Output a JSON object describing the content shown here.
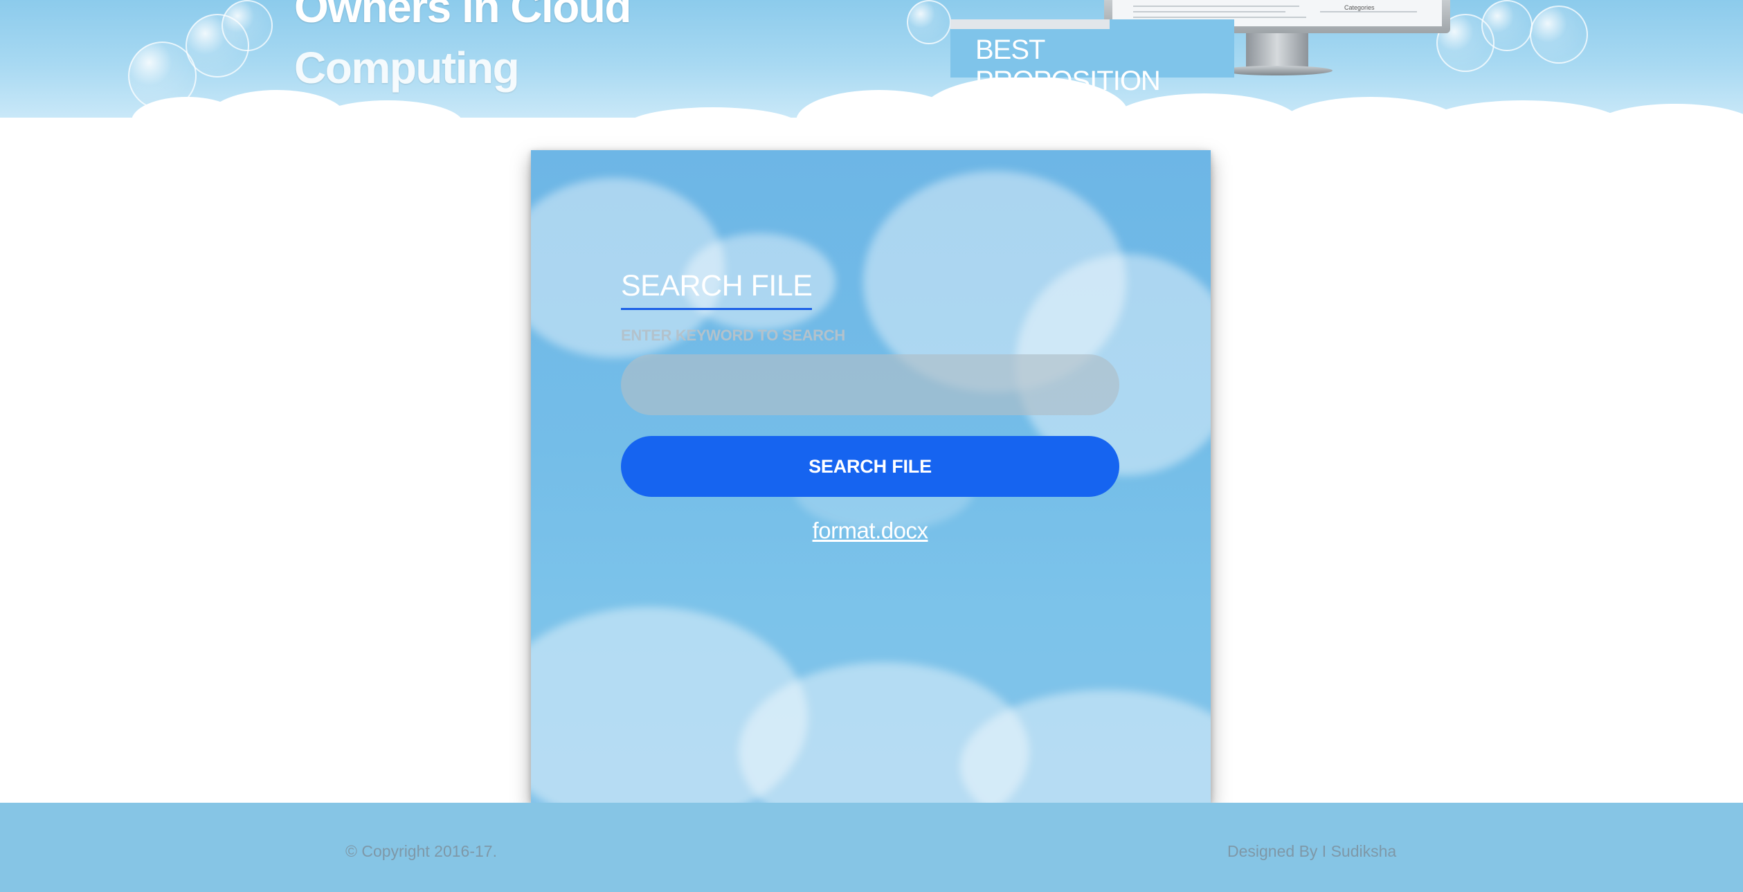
{
  "header": {
    "title_lines": [
      "Owners in Cloud",
      "Computing"
    ],
    "proposition_label": "BEST PROPOSITION",
    "monitor_screen_text": "Categories"
  },
  "search_panel": {
    "heading": "SEARCH FILE",
    "field_label": "ENTER KEYWORD TO SEARCH",
    "input_value": "",
    "input_placeholder": "",
    "button_label": "SEARCH FILE",
    "file_link": "format.docx"
  },
  "footer": {
    "copyright": "© Copyright 2016-17.",
    "designer": "Designed By I Sudiksha"
  },
  "colors": {
    "button_blue": "#1664f0",
    "footer_bg": "#86c5e5",
    "panel_sky": "#6db6e6",
    "heading_underline": "#1a5fe6"
  }
}
